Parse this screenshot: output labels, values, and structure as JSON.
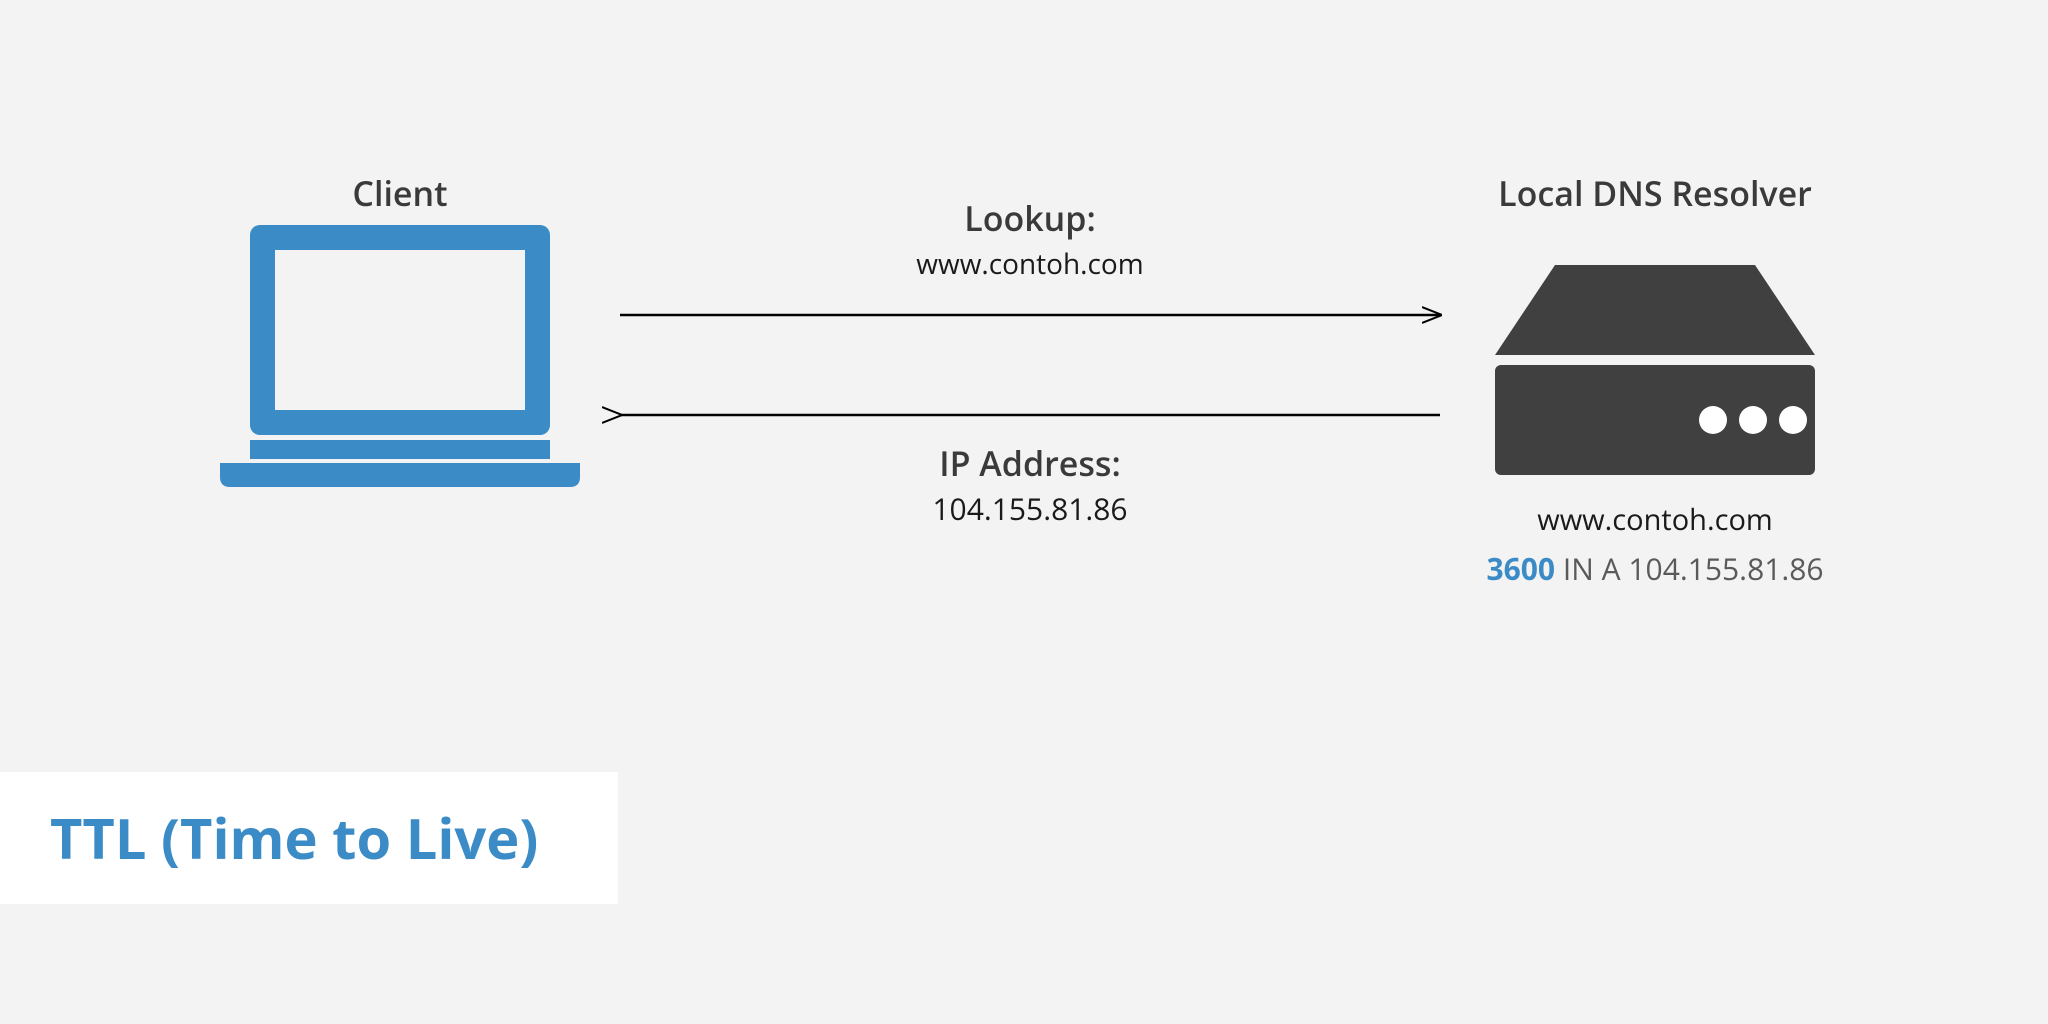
{
  "client": {
    "label": "Client"
  },
  "resolver": {
    "label": "Local DNS Resolver",
    "domain": "www.contoh.com",
    "record_ttl": "3600",
    "record_rest": "IN A 104.155.81.86"
  },
  "lookup": {
    "title": "Lookup:",
    "domain": "www.contoh.com"
  },
  "response": {
    "title": "IP Address:",
    "ip": "104.155.81.86"
  },
  "banner": {
    "title": "TTL (Time to Live)"
  },
  "colors": {
    "accent": "#3b8bc6",
    "dark": "#404040"
  }
}
